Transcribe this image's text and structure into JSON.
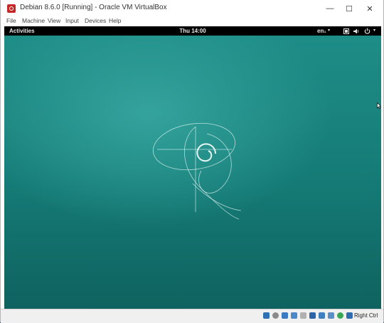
{
  "window": {
    "title": "Debian 8.6.0 [Running] - Oracle VM VirtualBox",
    "controls": {
      "minimize": "—",
      "maximize": "☐",
      "close": "✕"
    }
  },
  "menubar": {
    "items": [
      "File",
      "Machine",
      "View",
      "Input",
      "Devices",
      "Help"
    ]
  },
  "guest": {
    "topbar": {
      "activities": "Activities",
      "clock": "Thu 14:00",
      "language": "en₁",
      "caret": "▾",
      "tray_icons": [
        "screen-icon",
        "volume-icon",
        "power-icon"
      ]
    },
    "desktop": {
      "logo": "debian-swirl-logo",
      "accent": "#1f8d87"
    }
  },
  "statusbar": {
    "icons": [
      "hard-disk-icon",
      "optical-drive-icon",
      "audio-icon",
      "network-icon",
      "usb-icon",
      "shared-folders-icon",
      "display-icon",
      "video-capture-icon",
      "guest-additions-icon",
      "mouse-integration-icon",
      "keyboard-icon"
    ],
    "host_key": "Right Ctrl"
  }
}
